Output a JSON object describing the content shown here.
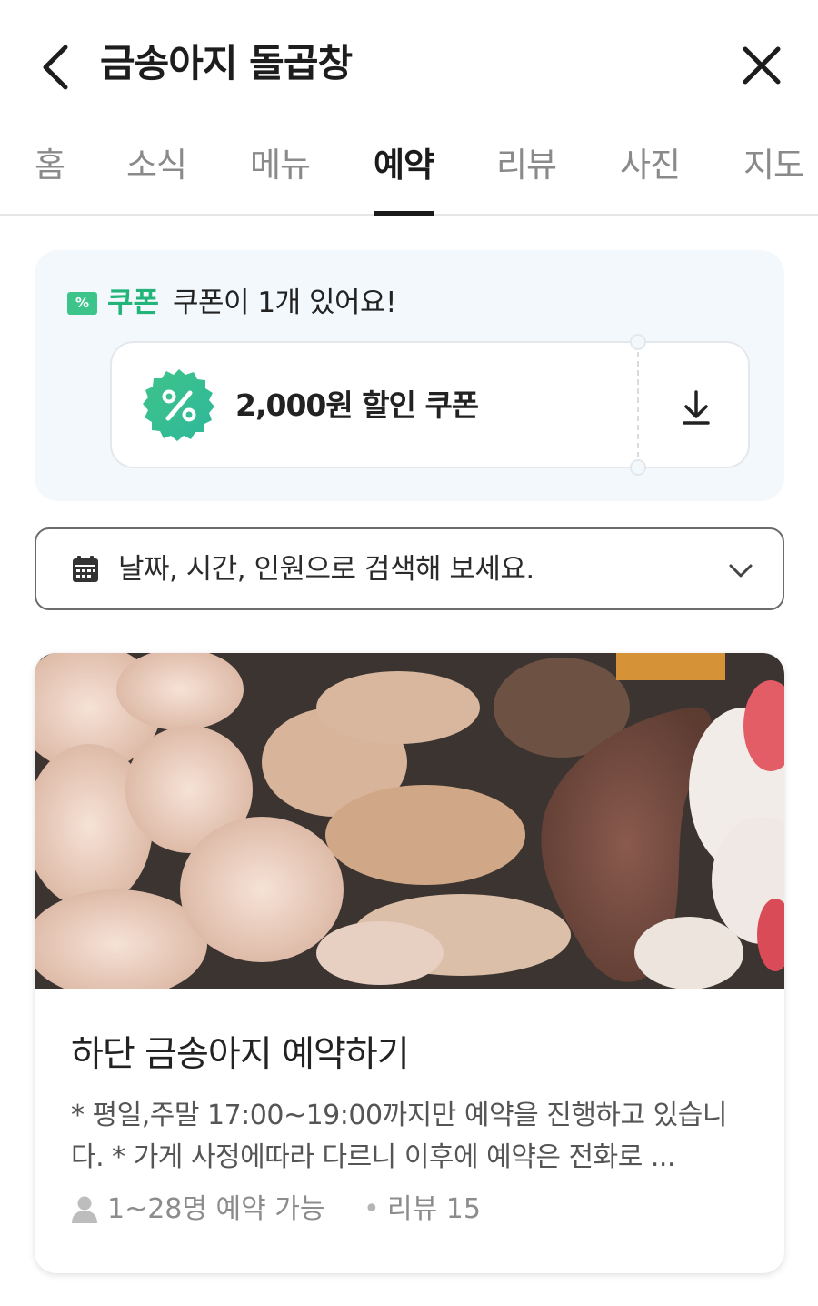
{
  "header": {
    "title": "금송아지 돌곱창"
  },
  "tabs": [
    {
      "label": "홈",
      "active": false
    },
    {
      "label": "소식",
      "active": false
    },
    {
      "label": "메뉴",
      "active": false
    },
    {
      "label": "예약",
      "active": true
    },
    {
      "label": "리뷰",
      "active": false
    },
    {
      "label": "사진",
      "active": false
    },
    {
      "label": "지도",
      "active": false
    }
  ],
  "coupon": {
    "label": "쿠폰",
    "count_text": "쿠폰이 1개 있어요!",
    "card_text": "2,000원 할인 쿠폰",
    "badge_icon": "percent-badge-icon",
    "accent_color": "#3dc48b"
  },
  "search": {
    "placeholder_text": "날짜, 시간, 인원으로 검색해 보세요."
  },
  "reservation_card": {
    "title": "하단 금송아지 예약하기",
    "description": "* 평일,주말 17:00~19:00까지만 예약을 진행하고 있습니다. * 가게 사정에따라 다르니 이후에 예약은 전화로 ...",
    "capacity": "1~28명 예약 가능",
    "separator": "•",
    "reviews": "리뷰 15"
  }
}
